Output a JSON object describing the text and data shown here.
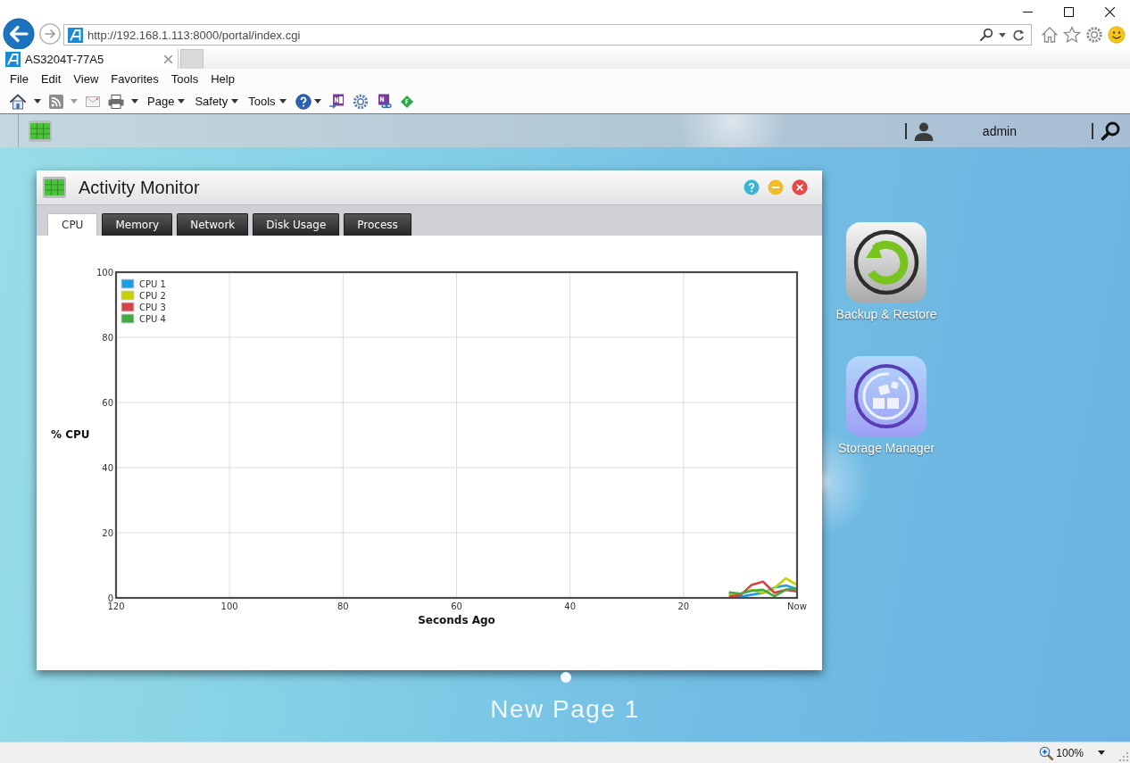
{
  "browser": {
    "url": "http://192.168.1.113:8000/portal/index.cgi",
    "tabs": [
      {
        "title": "AS3204T-77A5",
        "selected": true
      }
    ],
    "menu": [
      "File",
      "Edit",
      "View",
      "Favorites",
      "Tools",
      "Help"
    ],
    "command_menus": [
      "Page",
      "Safety",
      "Tools"
    ]
  },
  "portal": {
    "user": "admin",
    "window": {
      "title": "Activity Monitor",
      "tabs": [
        {
          "label": "CPU",
          "selected": true
        },
        {
          "label": "Memory",
          "selected": false
        },
        {
          "label": "Network",
          "selected": false
        },
        {
          "label": "Disk Usage",
          "selected": false
        },
        {
          "label": "Process",
          "selected": false
        }
      ],
      "chart_data": {
        "type": "line",
        "xlabel": "Seconds Ago",
        "ylabel": "% CPU",
        "x": [
          12,
          10,
          8,
          6,
          4,
          2,
          0
        ],
        "xlim": [
          120,
          0
        ],
        "ylim": [
          0,
          100
        ],
        "xticks": [
          120,
          100,
          80,
          60,
          40,
          20,
          {
            "value": 0,
            "label": "Now"
          }
        ],
        "yticks": [
          0,
          20,
          40,
          60,
          80,
          100
        ],
        "grid": true,
        "legend": true,
        "series": [
          {
            "name": "CPU 1",
            "color": "#1e9fe3",
            "values": [
              1.5,
              0.3,
              1,
              1.5,
              3.2,
              3.8,
              2.7
            ]
          },
          {
            "name": "CPU 2",
            "color": "#c5d200",
            "values": [
              1,
              1.2,
              2.5,
              1.5,
              3,
              6,
              4
            ]
          },
          {
            "name": "CPU 3",
            "color": "#d04545",
            "values": [
              0.5,
              0.8,
              4,
              5,
              1.6,
              2.5,
              2
            ]
          },
          {
            "name": "CPU 4",
            "color": "#45a845",
            "values": [
              1.7,
              1.3,
              2.2,
              2.5,
              0.5,
              2.5,
              3
            ]
          }
        ]
      }
    },
    "desktop_icons": [
      {
        "label": "Backup & Restore",
        "kind": "backup"
      },
      {
        "label": "Storage Manager",
        "kind": "storage"
      }
    ],
    "page_title": "New Page 1"
  },
  "status_bar": {
    "zoom": "100%"
  }
}
